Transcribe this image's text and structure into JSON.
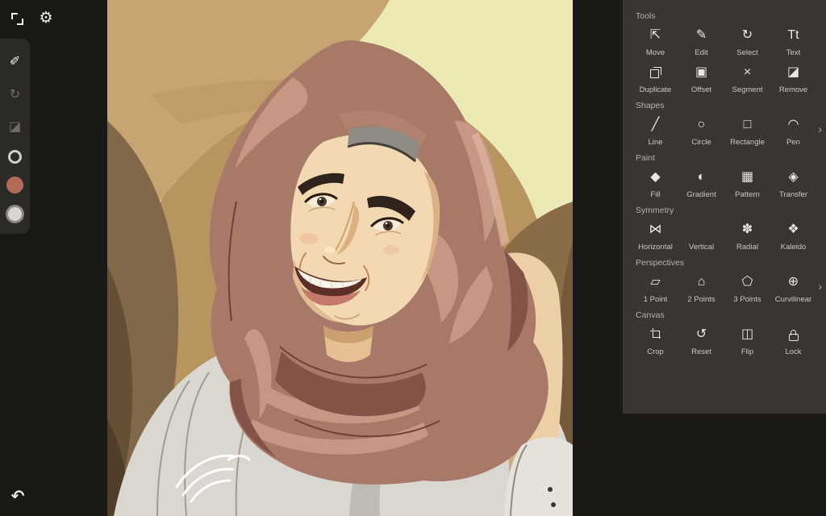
{
  "app": {
    "background_color": "#1b1916",
    "panel_color": "#393631",
    "rail_color": "#2c2a26"
  },
  "topbar": {
    "buttons": [
      {
        "icon": "expand",
        "name": "expand-icon"
      },
      {
        "icon": "gear",
        "name": "settings-gear-icon"
      }
    ]
  },
  "left_rail": {
    "tools": [
      {
        "icon": "brush",
        "name": "brush-tool",
        "active": true
      },
      {
        "icon": "lasso",
        "name": "select-rotate-tool",
        "active": false
      },
      {
        "icon": "eraser",
        "name": "eraser-tool",
        "active": false
      }
    ],
    "swatches": [
      {
        "name": "stroke-swatch",
        "type": "ring",
        "color": "#d2d0cb"
      },
      {
        "name": "fill-color-swatch",
        "type": "solid",
        "color": "#b06c56"
      },
      {
        "name": "secondary-color-swatch",
        "type": "outlined",
        "color": "#d8d6d3"
      }
    ]
  },
  "undo": {
    "icon": "undo",
    "name": "undo-icon"
  },
  "tool_panel": {
    "sections": [
      {
        "title": "Tools",
        "scrollable": false,
        "items": [
          {
            "icon": "move",
            "label": "Move"
          },
          {
            "icon": "edit",
            "label": "Edit"
          },
          {
            "icon": "select",
            "label": "Select"
          },
          {
            "icon": "text",
            "label": "Text"
          },
          {
            "icon": "duplicate",
            "label": "Duplicate"
          },
          {
            "icon": "offset",
            "label": "Offset"
          },
          {
            "icon": "segment",
            "label": "Segment"
          },
          {
            "icon": "remove",
            "label": "Remove"
          }
        ]
      },
      {
        "title": "Shapes",
        "scrollable": true,
        "items": [
          {
            "icon": "line",
            "label": "Line"
          },
          {
            "icon": "circle",
            "label": "Circle"
          },
          {
            "icon": "rectangle",
            "label": "Rectangle"
          },
          {
            "icon": "pen",
            "label": "Pen"
          }
        ]
      },
      {
        "title": "Paint",
        "scrollable": false,
        "items": [
          {
            "icon": "fill",
            "label": "Fill"
          },
          {
            "icon": "gradient",
            "label": "Gradient"
          },
          {
            "icon": "pattern",
            "label": "Pattern"
          },
          {
            "icon": "transfer",
            "label": "Transfer"
          }
        ]
      },
      {
        "title": "Symmetry",
        "scrollable": false,
        "items": [
          {
            "icon": "horizontal",
            "label": "Horizontal"
          },
          {
            "icon": "vertical",
            "label": "Vertical"
          },
          {
            "icon": "radial",
            "label": "Radial"
          },
          {
            "icon": "kaleido",
            "label": "Kaleido"
          }
        ]
      },
      {
        "title": "Perspectives",
        "scrollable": true,
        "items": [
          {
            "icon": "point1",
            "label": "1 Point"
          },
          {
            "icon": "point2",
            "label": "2 Points"
          },
          {
            "icon": "point3",
            "label": "3 Points"
          },
          {
            "icon": "curvilinear",
            "label": "Curvilinear"
          }
        ]
      },
      {
        "title": "Canvas",
        "scrollable": false,
        "items": [
          {
            "icon": "crop",
            "label": "Crop"
          },
          {
            "icon": "reset",
            "label": "Reset"
          },
          {
            "icon": "flip",
            "label": "Flip"
          },
          {
            "icon": "lock",
            "label": "Lock"
          }
        ]
      }
    ],
    "chevron_glyph": "›"
  },
  "artwork": {
    "subject": "vector pop-art portrait of a smiling woman wearing a rosy-brown hijab, cream and tan background",
    "signature_mark": true
  }
}
